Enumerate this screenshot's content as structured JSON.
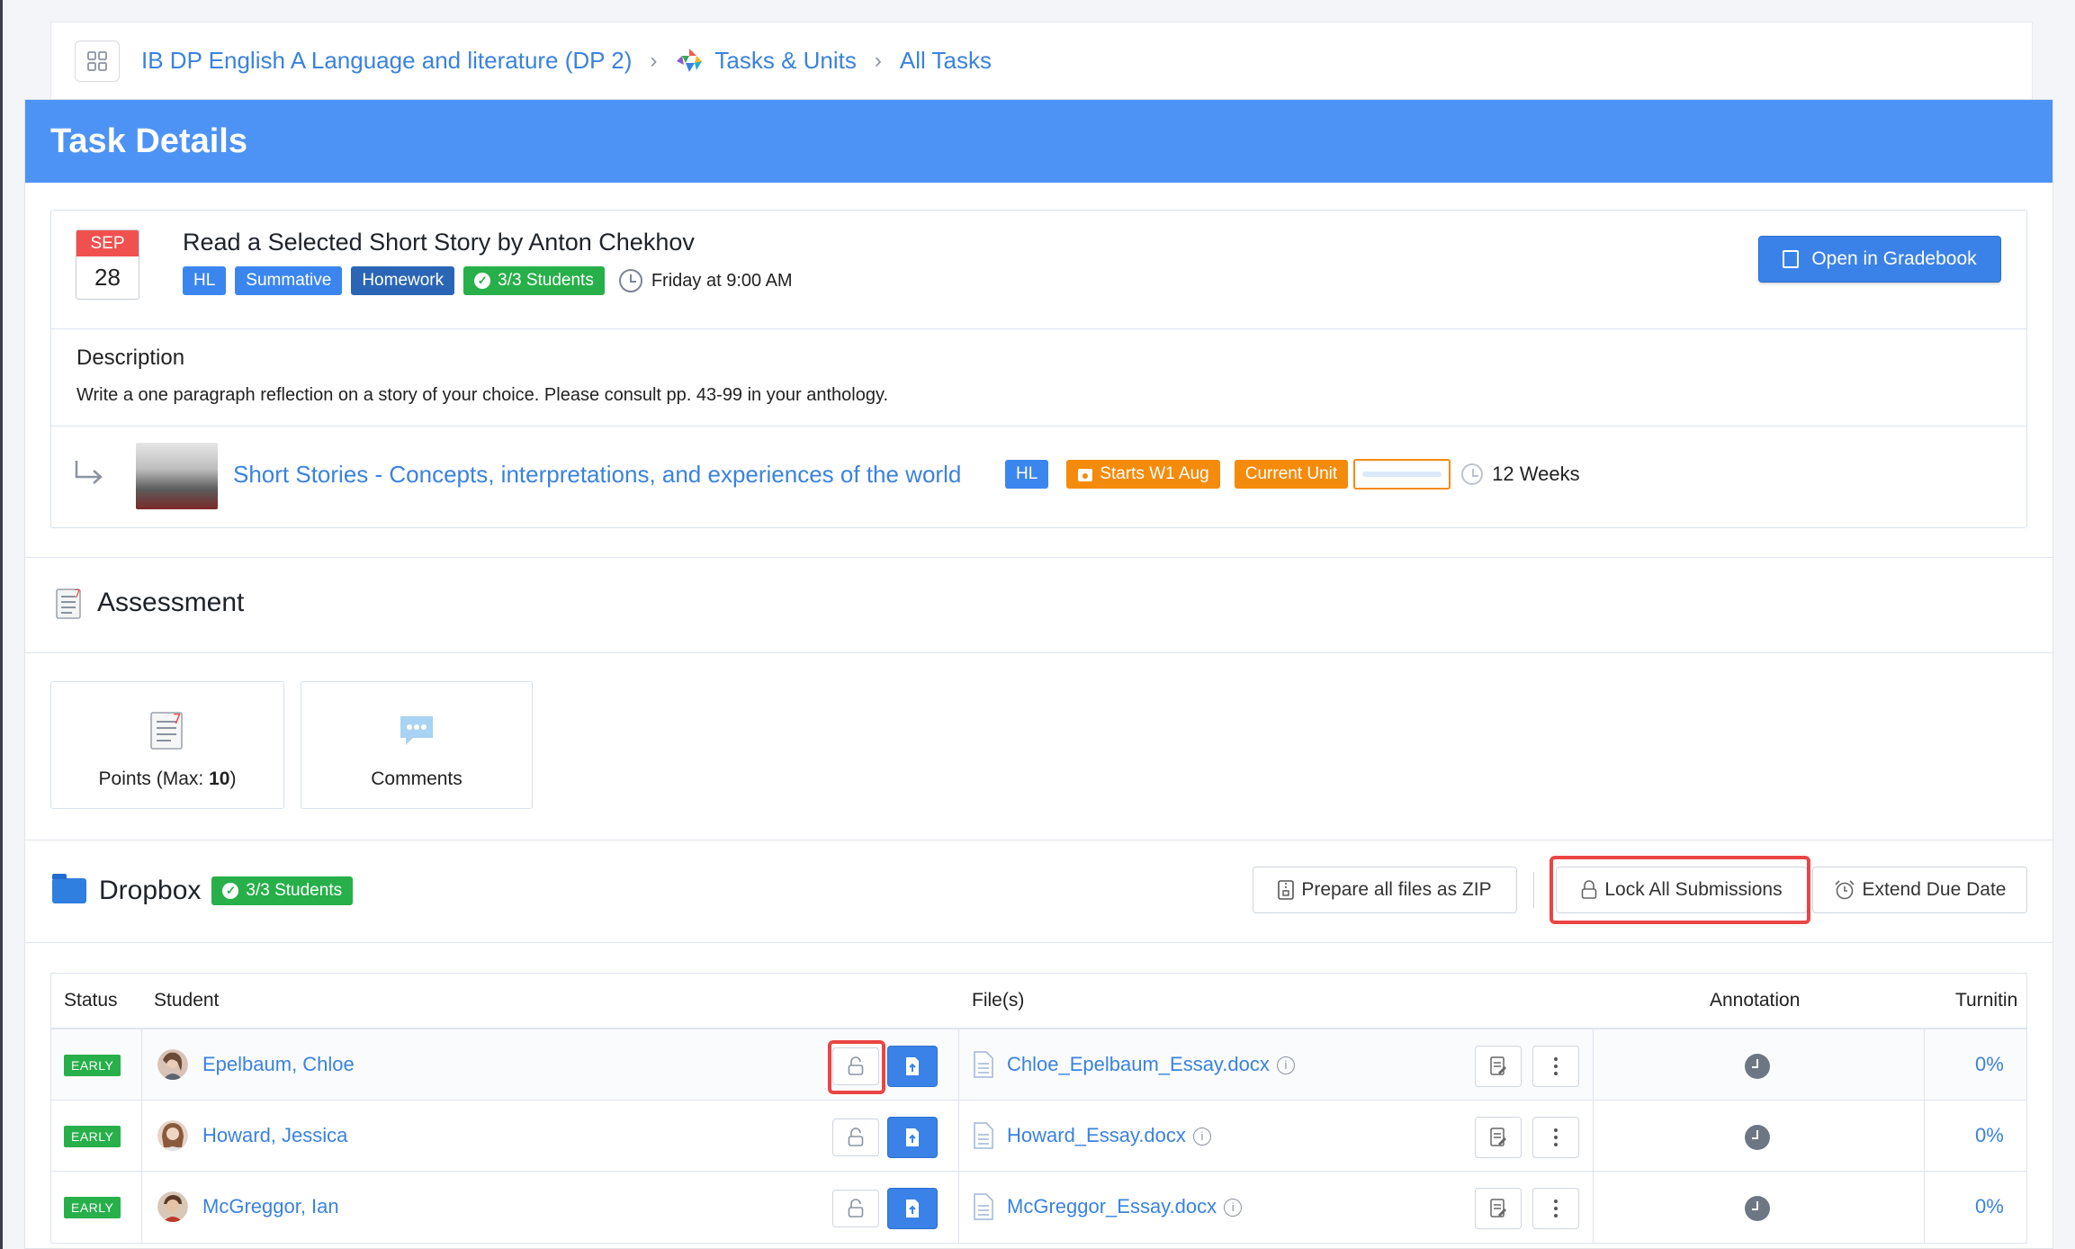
{
  "breadcrumb": {
    "course": "IB DP English A Language and literature (DP 2)",
    "section": "Tasks & Units",
    "page": "All Tasks"
  },
  "header": {
    "title": "Task Details"
  },
  "task": {
    "month": "SEP",
    "day": "28",
    "title": "Read a Selected Short Story by Anton Chekhov",
    "tags": [
      "HL",
      "Summative",
      "Homework"
    ],
    "students_badge": "3/3 Students",
    "due": "Friday at 9:00 AM",
    "gradebook_button": "Open in Gradebook"
  },
  "description": {
    "heading": "Description",
    "text": "Write a one paragraph reflection on a story of your choice. Please consult pp. 43-99 in your anthology."
  },
  "unit": {
    "title": "Short Stories - Concepts, interpretations, and experiences of the world",
    "level": "HL",
    "starts": "Starts W1 Aug",
    "current": "Current Unit",
    "progress": 0.0,
    "duration": "12 Weeks"
  },
  "assessment": {
    "heading": "Assessment",
    "points_label": "Points (Max: ",
    "points_max": "10",
    "points_close": ")",
    "comments_label": "Comments"
  },
  "dropbox": {
    "heading": "Dropbox",
    "students_badge": "3/3 Students",
    "zip_button": "Prepare all files as ZIP",
    "lock_button": "Lock All Submissions",
    "extend_button": "Extend Due Date"
  },
  "table": {
    "columns": {
      "status": "Status",
      "student": "Student",
      "files": "File(s)",
      "annotation": "Annotation",
      "turnitin": "Turnitin"
    },
    "rows": [
      {
        "status": "EARLY",
        "student": "Epelbaum, Chloe",
        "file": "Chloe_Epelbaum_Essay.docx",
        "turnitin": "0%"
      },
      {
        "status": "EARLY",
        "student": "Howard, Jessica",
        "file": "Howard_Essay.docx",
        "turnitin": "0%"
      },
      {
        "status": "EARLY",
        "student": "McGreggor, Ian",
        "file": "McGreggor_Essay.docx",
        "turnitin": "0%"
      }
    ]
  },
  "colors": {
    "header": "#4d93f5",
    "primary": "#3a82e8",
    "green": "#27b04a",
    "orange": "#f58b0b",
    "highlight": "#ea4545"
  }
}
